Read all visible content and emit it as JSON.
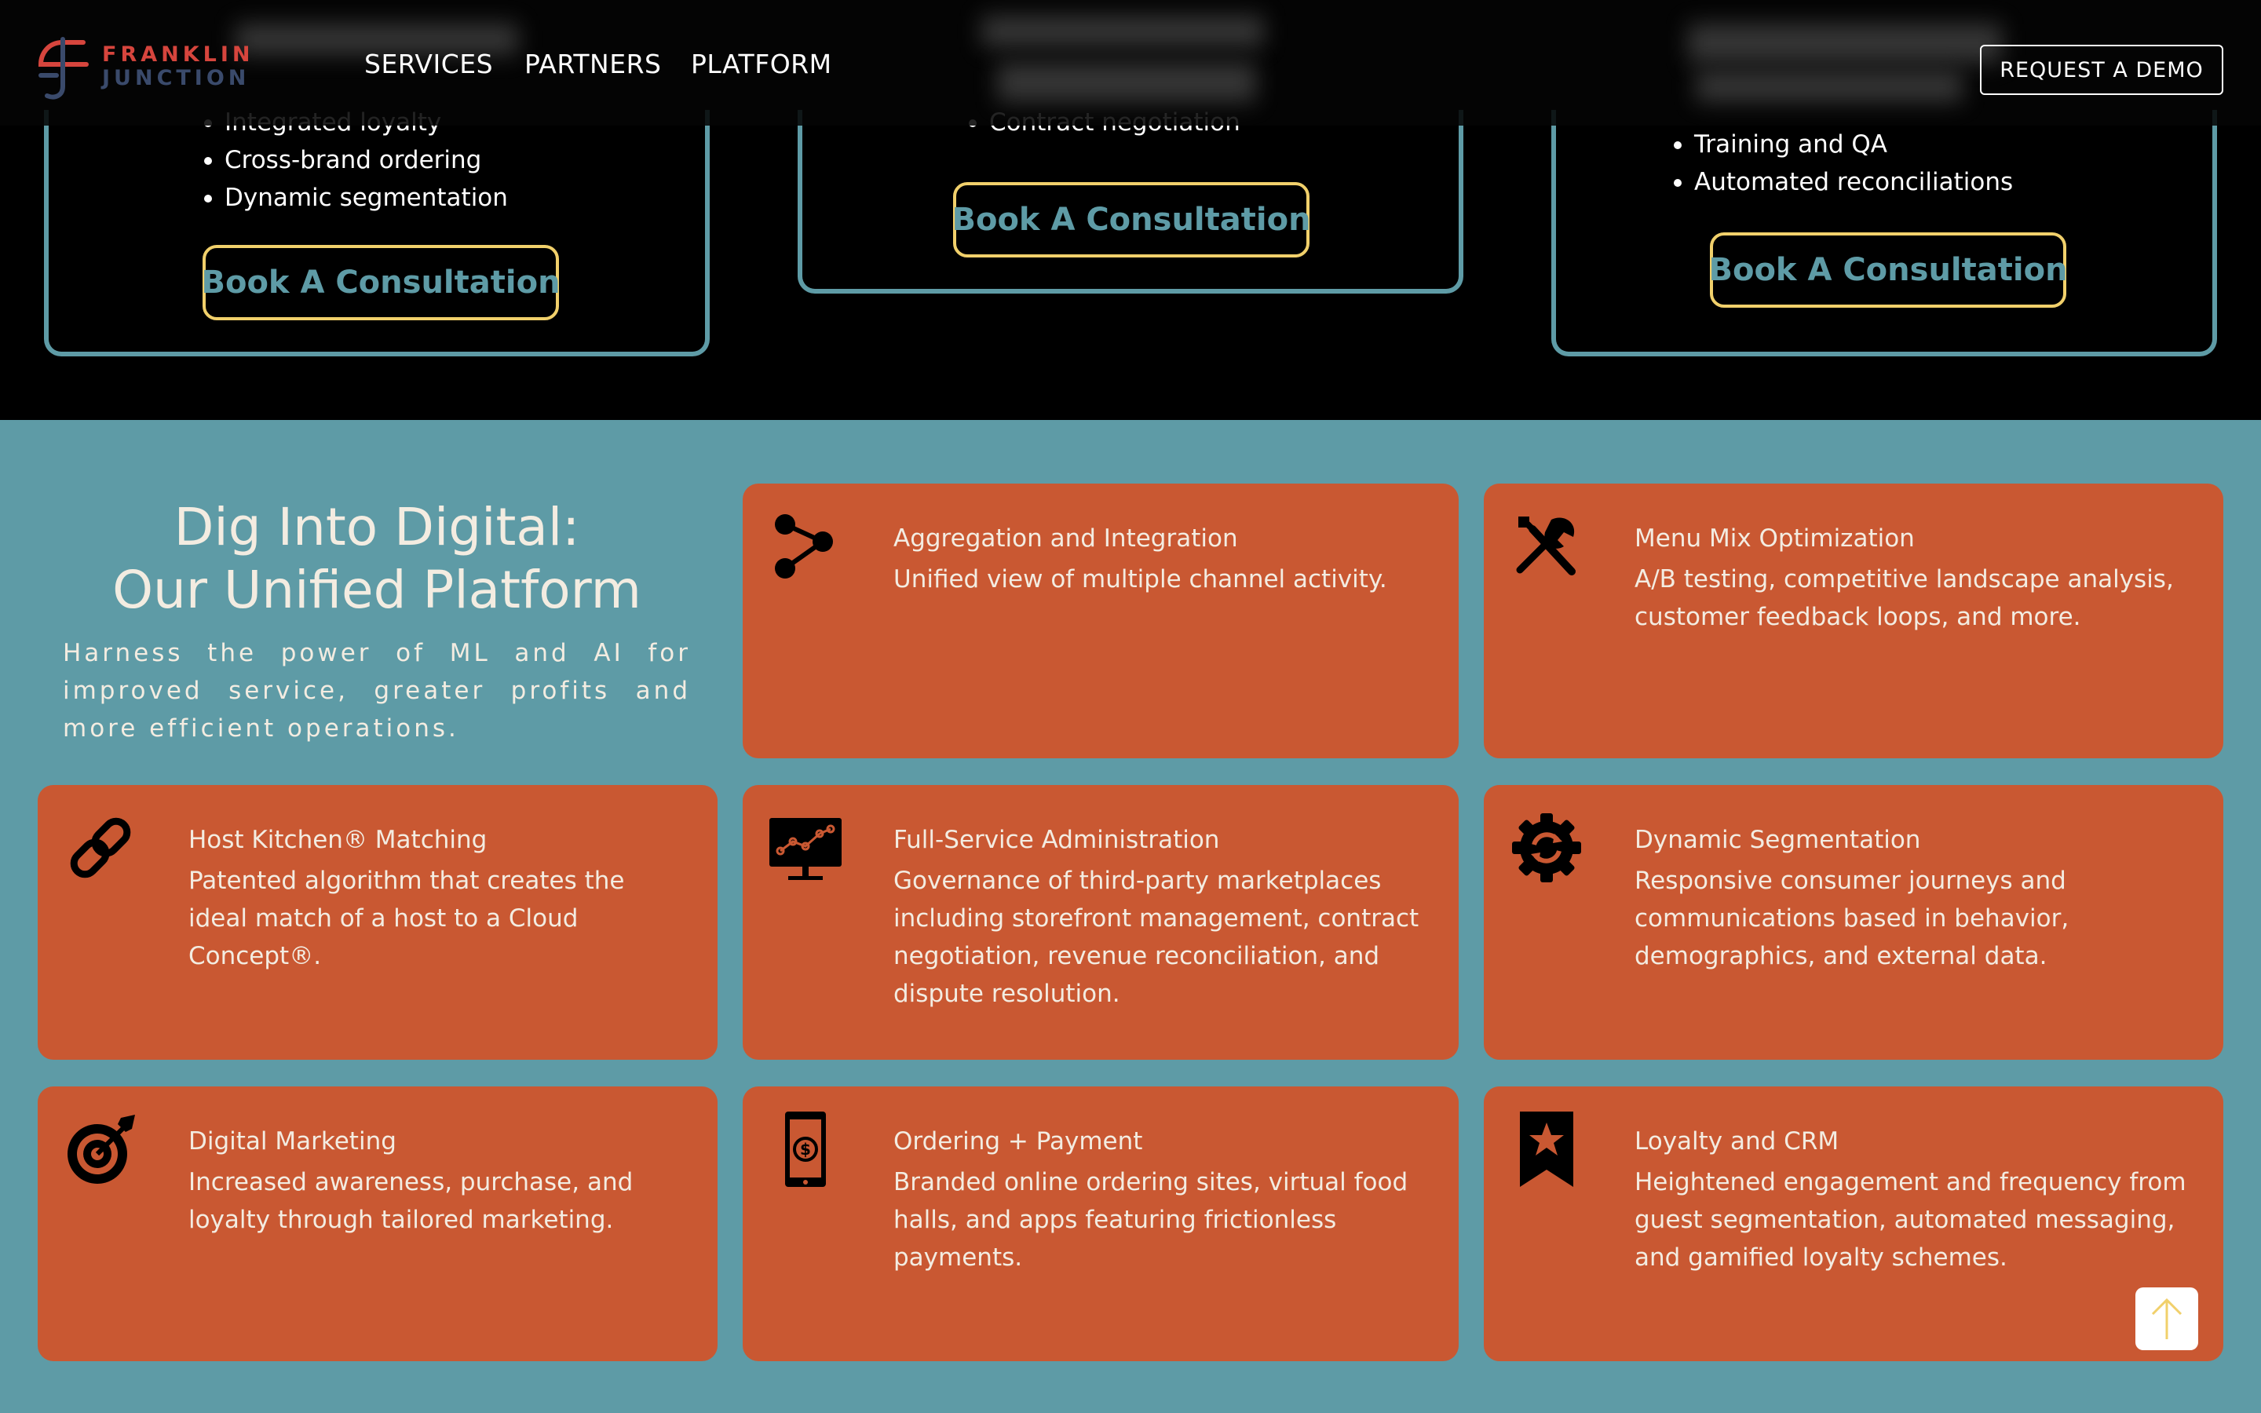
{
  "header": {
    "logo_line1": "FRANKLIN",
    "logo_line2": "JUNCTION",
    "nav": [
      "SERVICES",
      "PARTNERS",
      "PLATFORM"
    ],
    "cta": "REQUEST A DEMO"
  },
  "packages": [
    {
      "items": [
        "Integrated loyalty",
        "Cross-brand ordering",
        "Dynamic segmentation"
      ],
      "button": "Book A Consultation"
    },
    {
      "items": [
        "Contract negotiation"
      ],
      "button": "Book A Consultation"
    },
    {
      "items": [
        "Training and QA",
        "Automated reconciliations"
      ],
      "button": "Book A Consultation"
    }
  ],
  "platform": {
    "title_line1": "Dig Into Digital:",
    "title_line2": "Our Unified Platform",
    "description": "Harness the power of ML and AI for improved service, greater profits and more efficient operations."
  },
  "features": [
    {
      "icon": "share-nodes-icon",
      "title": "Aggregation and Integration",
      "description": "Unified view of multiple channel activity."
    },
    {
      "icon": "tools-icon",
      "title": "Menu Mix Optimization",
      "description": "A/B testing, competitive landscape analysis, customer feedback loops, and more."
    },
    {
      "icon": "link-icon",
      "title": "Host Kitchen® Matching",
      "description": "Patented algorithm that creates the ideal match of a host to a Cloud Concept®."
    },
    {
      "icon": "monitor-chart-icon",
      "title": "Full-Service Administration",
      "description": "Governance of third-party marketplaces including storefront management, contract negotiation, revenue reconciliation, and dispute resolution."
    },
    {
      "icon": "gear-sync-icon",
      "title": "Dynamic Segmentation",
      "description": "Responsive consumer journeys and communications based in behavior, demographics, and external data."
    },
    {
      "icon": "target-icon",
      "title": "Digital Marketing",
      "description": "Increased awareness, purchase, and loyalty through tailored marketing."
    },
    {
      "icon": "mobile-payment-icon",
      "title": "Ordering + Payment",
      "description": "Branded online ordering sites, virtual food halls, and apps featuring frictionless payments."
    },
    {
      "icon": "bookmark-star-icon",
      "title": "Loyalty and CRM",
      "description": "Heightened engagement and frequency from guest segmentation, automated messaging, and gamified loyalty schemes."
    }
  ],
  "scroll_top": {
    "icon": "arrow-up-icon"
  },
  "colors": {
    "teal": "#5e9ba6",
    "orange": "#c95832",
    "cream": "#f3ece1",
    "gold": "#f1d06b",
    "brand_red": "#d6453d",
    "brand_navy": "#3a4a6b"
  }
}
